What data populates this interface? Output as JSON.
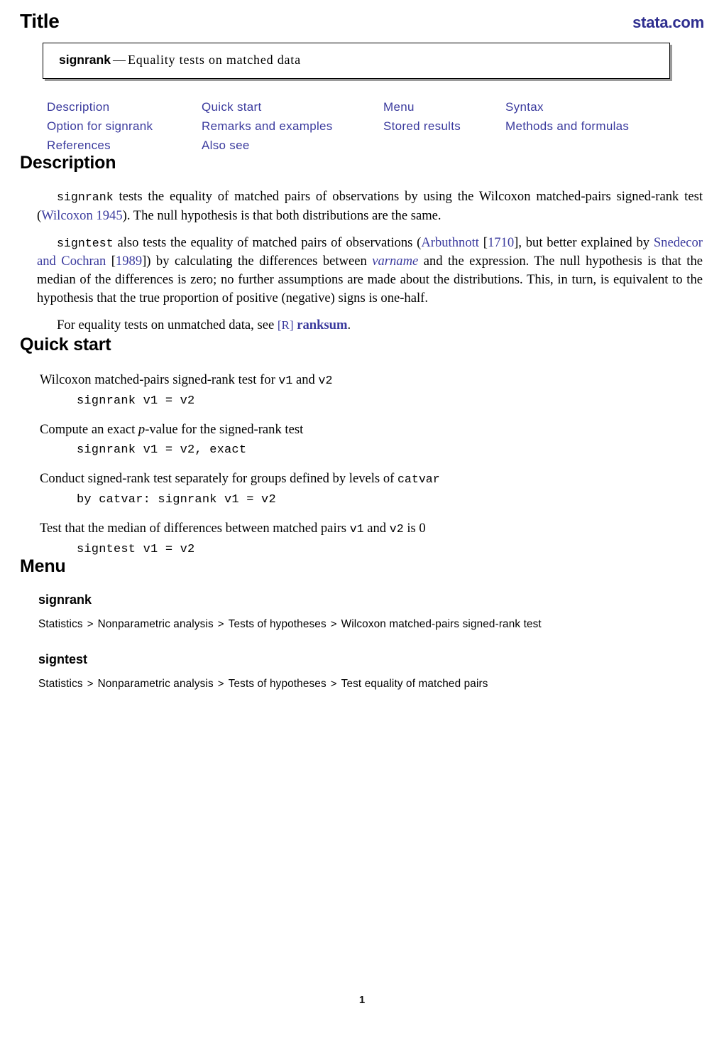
{
  "header": {
    "title": "Title",
    "site": "stata.com"
  },
  "title_box": {
    "command": "signrank",
    "dash": "—",
    "description": "Equality tests on matched data"
  },
  "nav_links": [
    "Description",
    "Quick start",
    "Menu",
    "Syntax",
    "Option for signrank",
    "Remarks and examples",
    "Stored results",
    "Methods and formulas",
    "References",
    "Also see"
  ],
  "sections": {
    "description": {
      "heading": "Description",
      "p1": {
        "cmd": "signrank",
        "t1": " tests the equality of matched pairs of observations by using the Wilcoxon matched-pairs signed-rank test (",
        "link1": "Wilcoxon 1945",
        "t2": "). The null hypothesis is that both distributions are the same."
      },
      "p2": {
        "cmd": "signtest",
        "t1": " also tests the equality of matched pairs of observations (",
        "link1": "Arbuthnott",
        "t2": " [",
        "link2": "1710",
        "t3": "], but better explained by ",
        "link3": "Snedecor and Cochran",
        "t4": " [",
        "link4": "1989",
        "t5": "]) by calculating the differences between ",
        "ital1": "varname",
        "t6": " and the expression. The null hypothesis is that the median of the differences is zero; no further assumptions are made about the distributions. This, in turn, is equivalent to the hypothesis that the true proportion of positive (negative) signs is one-half."
      },
      "p3": {
        "t1": "For equality tests on unmatched data, see ",
        "ref_bracket": "[R]",
        "ref_bold": "ranksum",
        "t2": "."
      }
    },
    "quick_start": {
      "heading": "Quick start",
      "items": [
        {
          "desc_pre": "Wilcoxon matched-pairs signed-rank test for ",
          "desc_mono1": "v1",
          "desc_mid": " and ",
          "desc_mono2": "v2",
          "desc_post": "",
          "code": "signrank v1 = v2"
        },
        {
          "desc_pre": "Compute an exact ",
          "desc_ital": "p",
          "desc_post": "-value for the signed-rank test",
          "code": "signrank v1 = v2, exact"
        },
        {
          "desc_pre": "Conduct signed-rank test separately for groups defined by levels of ",
          "desc_mono1": "catvar",
          "desc_post": "",
          "code": "by catvar: signrank v1 = v2"
        },
        {
          "desc_pre": "Test that the median of differences between matched pairs ",
          "desc_mono1": "v1",
          "desc_mid": " and ",
          "desc_mono2": "v2",
          "desc_post": " is 0",
          "code": "signtest v1 = v2"
        }
      ]
    },
    "menu": {
      "heading": "Menu",
      "groups": [
        {
          "command": "signrank",
          "path": [
            "Statistics",
            "Nonparametric analysis",
            "Tests of hypotheses",
            "Wilcoxon matched-pairs signed-rank test"
          ]
        },
        {
          "command": "signtest",
          "path": [
            "Statistics",
            "Nonparametric analysis",
            "Tests of hypotheses",
            "Test equality of matched pairs"
          ]
        }
      ],
      "separator": ">"
    }
  },
  "footer": {
    "page_number": "1"
  },
  "colors": {
    "link": "#3b3b9e",
    "logo": "#2e2e8f",
    "text": "#000000"
  }
}
